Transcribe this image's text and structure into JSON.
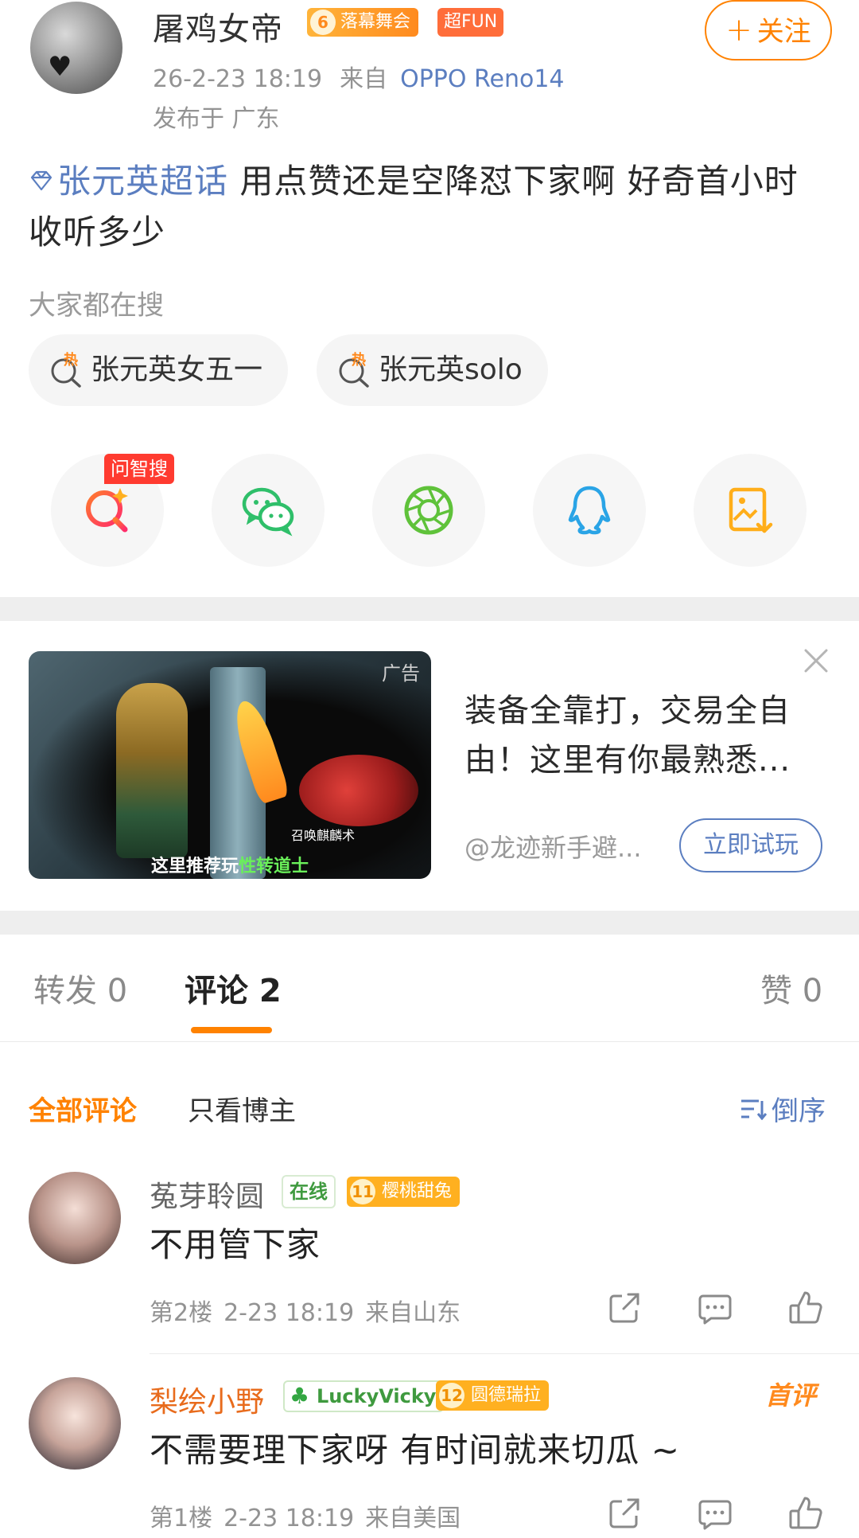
{
  "post": {
    "username": "屠鸡女帝",
    "fan_badge_level": "6",
    "fan_badge_label": "落幕舞会",
    "fun_badge": "超FUN",
    "follow_label": "关注",
    "time": "26-2-23 18:19",
    "source_prefix": "来自",
    "device": "OPPO Reno14",
    "location": "发布于 广东",
    "topic": "张元英超话",
    "body": "用点赞还是空降怼下家啊 好奇首小时收听多少"
  },
  "search": {
    "label": "大家都在搜",
    "chips": [
      "张元英女五一",
      "张元英solo"
    ]
  },
  "share": {
    "ask_tag": "问智搜",
    "icons": [
      "ai-search-icon",
      "wechat-icon",
      "moments-icon",
      "qq-icon",
      "save-image-icon"
    ]
  },
  "ad": {
    "tag": "广告",
    "caption_prefix": "这里推荐玩",
    "caption_highlight": "性转道士",
    "sub_caption": "召唤麒麟术",
    "text": "装备全靠打，交易全自由！这里有你最熟悉...",
    "source": "@龙迹新手避...",
    "cta": "立即试玩"
  },
  "tabs": {
    "repost": "转发 0",
    "comment": "评论 2",
    "like": "赞 0"
  },
  "filters": {
    "all": "全部评论",
    "owner": "只看博主",
    "sort": "倒序"
  },
  "comments": [
    {
      "name": "菟芽聆圆",
      "online": "在线",
      "fan_level": "11",
      "fan_label": "樱桃甜兔",
      "text": "不用管下家",
      "floor": "第2楼",
      "time": "2-23 18:19",
      "location": "来自山东"
    },
    {
      "name": "梨绘小野",
      "lucky": "LuckyVicky",
      "fan_level": "12",
      "fan_label": "圆德瑞拉",
      "first_tag": "首评",
      "text": "不需要理下家呀 有时间就来切瓜 ~",
      "floor": "第1楼",
      "time": "2-23 18:19",
      "location": "来自美国"
    }
  ],
  "colors": {
    "accent": "#ff8200",
    "link": "#5b7ec0",
    "meta": "#939393"
  }
}
